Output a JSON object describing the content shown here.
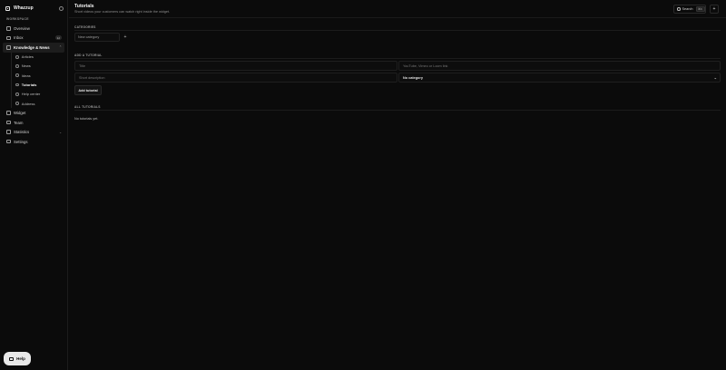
{
  "app": {
    "name": "Whazzup",
    "section_label": "WORKSPACE"
  },
  "sidebar": {
    "items": [
      {
        "label": "Overview",
        "icon": "grid-icon"
      },
      {
        "label": "Inbox",
        "icon": "inbox-icon",
        "badge": "12"
      },
      {
        "label": "Knowledge & News",
        "icon": "book-icon",
        "active": true
      },
      {
        "label": "Widget",
        "icon": "widget-icon"
      },
      {
        "label": "Team",
        "icon": "team-icon"
      },
      {
        "label": "Statistics",
        "icon": "chart-icon"
      },
      {
        "label": "Settings",
        "icon": "gear-icon"
      }
    ],
    "sub_items": [
      {
        "label": "Articles",
        "icon": "article-icon"
      },
      {
        "label": "News",
        "icon": "news-icon"
      },
      {
        "label": "Ideas",
        "icon": "idea-icon"
      },
      {
        "label": "Tutorials",
        "icon": "play-icon",
        "active": true
      },
      {
        "label": "Help center",
        "icon": "help-center-icon"
      },
      {
        "label": "Address",
        "icon": "pin-icon"
      }
    ],
    "help_label": "Help"
  },
  "header": {
    "title": "Tutorials",
    "subtitle": "Short videos your customers can watch right inside the widget.",
    "search_label": "Search",
    "search_shortcut": "⌘K",
    "add_label": "+"
  },
  "categories": {
    "heading": "CATEGORIES",
    "input_placeholder": "New category",
    "add_label": "+"
  },
  "add_tutorial": {
    "heading": "ADD A TUTORIAL",
    "title_placeholder": "Title",
    "url_placeholder": "YouTube, Vimeo or Loom link",
    "description_placeholder": "Short description",
    "category_value": "No category",
    "button_label": "Add tutorial"
  },
  "all_tutorials": {
    "heading": "ALL TUTORIALS",
    "empty_text": "No tutorials yet."
  },
  "colors": {
    "background": "#0b0b0b",
    "sidebar_active": "#1d1d1d",
    "border": "#1f1f1f",
    "help_button": "#e9e9e9"
  }
}
